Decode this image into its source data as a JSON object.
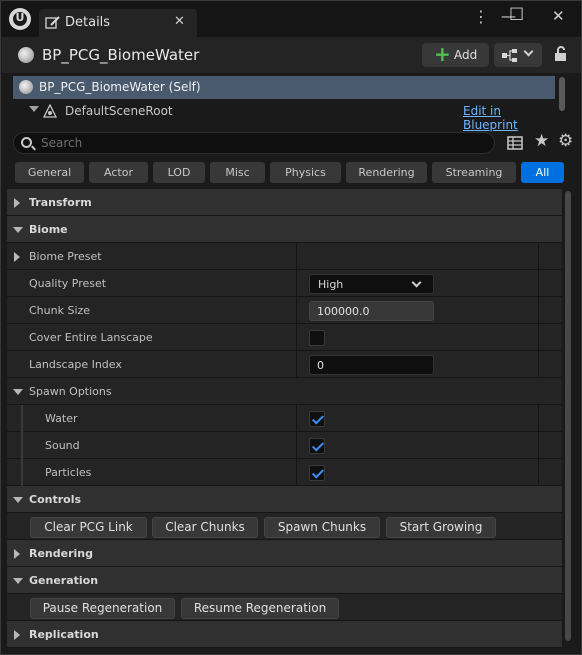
{
  "window": {
    "tab_title": "Details",
    "tab_close": "✕",
    "menu_icon": "⋮",
    "minimize": "—",
    "maximize": "☐",
    "close": "✕"
  },
  "header": {
    "title": "BP_PCG_BiomeWater",
    "add_label": "Add"
  },
  "components": {
    "self_label": "BP_PCG_BiomeWater (Self)",
    "root_label": "DefaultSceneRoot",
    "edit_link": "Edit in Blueprint"
  },
  "search": {
    "placeholder": "Search"
  },
  "category_tabs": [
    {
      "label": "General",
      "active": false
    },
    {
      "label": "Actor",
      "active": false
    },
    {
      "label": "LOD",
      "active": false
    },
    {
      "label": "Misc",
      "active": false
    },
    {
      "label": "Physics",
      "active": false
    },
    {
      "label": "Rendering",
      "active": false
    },
    {
      "label": "Streaming",
      "active": false
    },
    {
      "label": "All",
      "active": true
    }
  ],
  "properties": {
    "transform": "Transform",
    "biome": "Biome",
    "biome_preset": "Biome Preset",
    "quality_preset": "Quality Preset",
    "quality_value": "High",
    "chunk_size": "Chunk Size",
    "chunk_value": "100000.0",
    "cover_entire": "Cover Entire Lanscape",
    "cover_checked": false,
    "landscape_index": "Landscape Index",
    "landscape_value": "0",
    "spawn_options": "Spawn Options",
    "water": "Water",
    "water_checked": true,
    "sound": "Sound",
    "sound_checked": true,
    "particles": "Particles",
    "particles_checked": true,
    "controls": "Controls",
    "clear_pcg": "Clear PCG Link",
    "clear_chunks": "Clear Chunks",
    "spawn_chunks": "Spawn Chunks",
    "start_growing": "Start Growing",
    "rendering": "Rendering",
    "generation": "Generation",
    "pause_regen": "Pause Regeneration",
    "resume_regen": "Resume Regeneration",
    "replication": "Replication"
  },
  "colors": {
    "accent": "#0070e0",
    "selected_row": "#4a5a6e",
    "link": "#6fb6ff",
    "add_plus": "#50c050"
  }
}
